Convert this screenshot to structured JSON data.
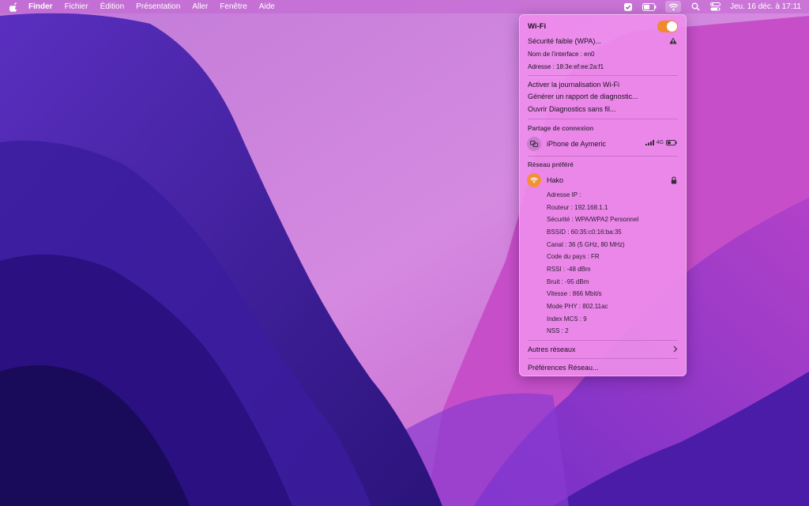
{
  "menubar": {
    "apple_icon": "apple-logo-icon",
    "items": [
      "Finder",
      "Fichier",
      "Édition",
      "Présentation",
      "Aller",
      "Fenêtre",
      "Aide"
    ],
    "status_icons": [
      "shield-check-icon",
      "battery-icon",
      "wifi-icon",
      "search-icon",
      "control-center-icon"
    ],
    "clock": "Jeu. 16 déc. à  17:11"
  },
  "wifi_menu": {
    "title": "Wi-Fi",
    "toggle_on": true,
    "accent_color": "#f08a2c",
    "security_warning": "Sécurité faible (WPA)...",
    "interface_name": "Nom de l’interface : en0",
    "address": "Adresse : 18:3e:ef:ee:2a:f1",
    "actions": [
      "Activer la journalisation Wi-Fi",
      "Générer un rapport de diagnostic...",
      "Ouvrir Diagnostics sans fil..."
    ],
    "hotspot_header": "Partage de connexion",
    "hotspot_name": "iPhone de Aymeric",
    "hotspot_network": "4G",
    "preferred_header": "Réseau préféré",
    "network_name": "Hako",
    "details": [
      "Adresse IP :",
      "Routeur : 192.168.1.1",
      "Sécurité : WPA/WPA2 Personnel",
      "BSSID : 60:35:c0:16:ba:35",
      "Canal : 36 (5 GHz, 80 MHz)",
      "Code du pays : FR",
      "RSSI : -48 dBm",
      "Bruit : -95 dBm",
      "Vitesse : 866 Mbit/s",
      "Mode PHY : 802.11ac",
      "Index MCS : 9",
      "NSS : 2"
    ],
    "other_networks": "Autres réseaux",
    "preferences": "Préférences Réseau..."
  }
}
